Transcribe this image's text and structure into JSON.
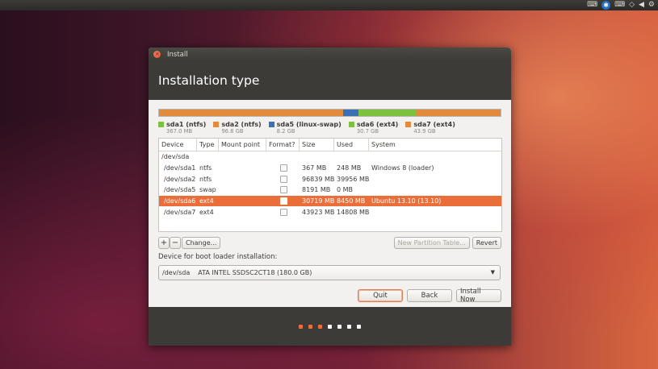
{
  "tray": {
    "icons": [
      "keyboard-icon",
      "accessibility-icon",
      "keyboard-layout-icon",
      "network-icon",
      "volume-icon",
      "settings-gear-icon"
    ]
  },
  "window": {
    "title": "Install",
    "header": "Installation type"
  },
  "partition_bar": [
    {
      "name": "sda1",
      "color": "#e28b3b",
      "fraction": 0.0023
    },
    {
      "name": "sda2",
      "color": "#e28b3b",
      "fraction": 0.536
    },
    {
      "name": "sda5",
      "color": "#3b6fb6",
      "fraction": 0.045
    },
    {
      "name": "sda6",
      "color": "#7cc23d",
      "fraction": 0.17
    },
    {
      "name": "sda7",
      "color": "#e28b3b",
      "fraction": 0.2467
    }
  ],
  "legend": [
    {
      "label": "sda1 (ntfs)",
      "size": "367.0 MB",
      "color": "#7cc23d"
    },
    {
      "label": "sda2 (ntfs)",
      "size": "96.8 GB",
      "color": "#e28b3b"
    },
    {
      "label": "sda5 (linux-swap)",
      "size": "8.2 GB",
      "color": "#3b6fb6"
    },
    {
      "label": "sda6 (ext4)",
      "size": "30.7 GB",
      "color": "#7cc23d"
    },
    {
      "label": "sda7 (ext4)",
      "size": "43.9 GB",
      "color": "#e28b3b"
    }
  ],
  "table": {
    "headers": [
      "Device",
      "Type",
      "Mount point",
      "Format?",
      "Size",
      "Used",
      "System"
    ],
    "rows": [
      {
        "device": "/dev/sda",
        "type": "",
        "mount": "",
        "format": false,
        "size": "",
        "used": "",
        "system": "",
        "is_disk": true
      },
      {
        "device": "/dev/sda1",
        "type": "ntfs",
        "mount": "",
        "format": false,
        "size": "367 MB",
        "used": "248 MB",
        "system": "Windows 8 (loader)"
      },
      {
        "device": "/dev/sda2",
        "type": "ntfs",
        "mount": "",
        "format": false,
        "size": "96839 MB",
        "used": "39956 MB",
        "system": ""
      },
      {
        "device": "/dev/sda5",
        "type": "swap",
        "mount": "",
        "format": false,
        "size": "8191 MB",
        "used": "0 MB",
        "system": ""
      },
      {
        "device": "/dev/sda6",
        "type": "ext4",
        "mount": "",
        "format": false,
        "size": "30719 MB",
        "used": "8450 MB",
        "system": "Ubuntu 13.10 (13.10)",
        "selected": true
      },
      {
        "device": "/dev/sda7",
        "type": "ext4",
        "mount": "",
        "format": false,
        "size": "43923 MB",
        "used": "14808 MB",
        "system": ""
      }
    ]
  },
  "toolbar": {
    "add_label": "+",
    "remove_label": "−",
    "change_label": "Change...",
    "new_table_label": "New Partition Table...",
    "revert_label": "Revert"
  },
  "boot": {
    "label": "Device for boot loader installation:",
    "device": "/dev/sda",
    "description": "ATA INTEL SSDSC2CT18 (180.0 GB)"
  },
  "actions": {
    "quit": "Quit",
    "back": "Back",
    "install": "Install Now"
  },
  "progress_dots": {
    "total": 7,
    "completed": 3,
    "active_color": "#e96e3a",
    "inactive_color": "#ffffff"
  }
}
